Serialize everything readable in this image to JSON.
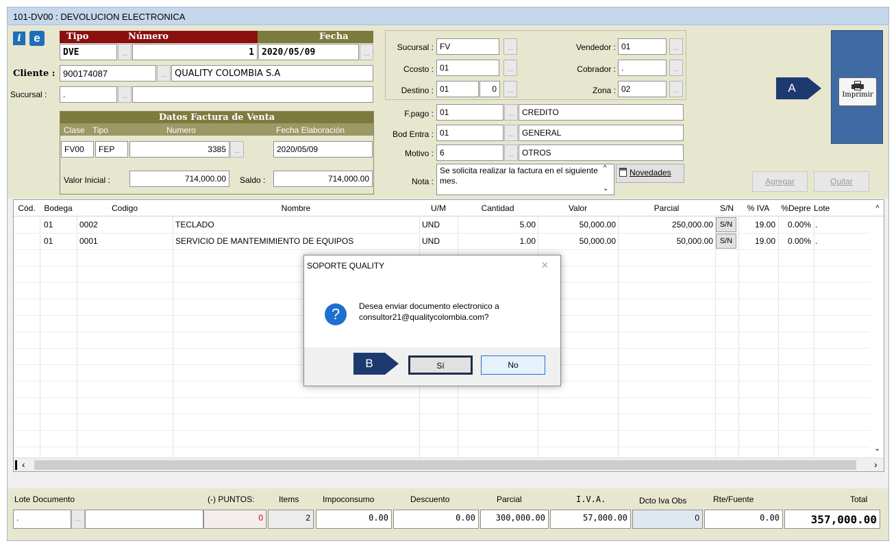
{
  "window": {
    "title": "101-DV00 : DEVOLUCION ELECTRONICA"
  },
  "header": {
    "info_icon": "i",
    "e_icon": "e",
    "tipo_label": "Tipo",
    "numero_label": "Número",
    "fecha_label": "Fecha",
    "tipo_value": "DVE",
    "numero_value": "1",
    "fecha_value": "2020/05/09",
    "cliente_label": "Cliente :",
    "cliente_code": "900174087",
    "cliente_name": "QUALITY COLOMBIA S.A",
    "sucursal_label": "Sucursal :",
    "sucursal_value": ".",
    "dots": "...",
    "datos_title": "Datos Factura de Venta",
    "datos_clase_label": "Clase",
    "datos_tipo_label": "Tipo",
    "datos_numero_label": "Numero",
    "datos_fecha_label": "Fecha Elaboración",
    "datos_clase": "FV00",
    "datos_tipo": "FEP",
    "datos_numero": "3385",
    "datos_fecha": "2020/05/09",
    "valor_inicial_label": "Valor Inicial :",
    "valor_inicial": "714,000.00",
    "saldo_label": "Saldo :",
    "saldo": "714,000.00"
  },
  "middle": {
    "sucursal_label": "Sucursal :",
    "sucursal": "FV",
    "ccosto_label": "Ccosto :",
    "ccosto": "01",
    "destino_label": "Destino :",
    "destino": "01",
    "destino2": "0",
    "vendedor_label": "Vendedor :",
    "vendedor": "01",
    "cobrador_label": "Cobrador :",
    "cobrador": ".",
    "zona_label": "Zona :",
    "zona": "02",
    "fpago_label": "F.pago :",
    "fpago": "01",
    "fpago_desc": "CREDITO",
    "bod_label": "Bod Entra :",
    "bod": "01",
    "bod_desc": "GENERAL",
    "motivo_label": "Motivo :",
    "motivo": "6",
    "motivo_desc": "OTROS",
    "nota_label": "Nota :",
    "nota": "Se solicita realizar la factura en el siguiente mes.",
    "novedades_label": "Novedades"
  },
  "right": {
    "imprimir_label": "Imprimir",
    "agregar_label": "Agregar",
    "quitar_label": "Quitar",
    "callout_a": "A",
    "callout_b": "B"
  },
  "grid": {
    "columns": [
      "Cód.",
      "Bodega",
      "Codigo",
      "Nombre",
      "U/M",
      "Cantidad",
      "Valor",
      "Parcial",
      "S/N",
      "% IVA",
      "%Depre",
      "Lote"
    ],
    "rows": [
      {
        "bodega": "01",
        "codigo": "0002",
        "nombre": "TECLADO",
        "um": "UND",
        "cantidad": "5.00",
        "valor": "50,000.00",
        "parcial": "250,000.00",
        "sn": "S/N",
        "iva": "19.00",
        "depre": "0.00%",
        "lote": "."
      },
      {
        "bodega": "01",
        "codigo": "0001",
        "nombre": "SERVICIO DE MANTEMIMIENTO DE EQUIPOS",
        "um": "UND",
        "cantidad": "1.00",
        "valor": "50,000.00",
        "parcial": "50,000.00",
        "sn": "S/N",
        "iva": "19.00",
        "depre": "0.00%",
        "lote": "."
      }
    ]
  },
  "dialog": {
    "title": "SOPORTE QUALITY",
    "message": "Desea enviar documento electronico a consultor21@qualitycolombia.com?",
    "yes": "Sí",
    "no": "No"
  },
  "footer": {
    "lote_label": "Lote Documento",
    "puntos_label": "(-) PUNTOS:",
    "items_label": "Items",
    "impoconsumo_label": "Impoconsumo",
    "descuento_label": "Descuento",
    "parcial_label": "Parcial",
    "iva_label": "I.V.A.",
    "dcto_label": "Dcto Iva Obs",
    "rte_label": "Rte/Fuente",
    "total_label": "Total",
    "lote": ".",
    "puntos": "0",
    "items": "2",
    "impoconsumo": "0.00",
    "descuento": "0.00",
    "parcial": "300,000.00",
    "iva": "57,000.00",
    "dcto": "0",
    "rte": "0.00",
    "total": "357,000.00"
  },
  "colors": {
    "accent_red": "#8a0f0f",
    "accent_olive": "#7d7a3e",
    "panel_bg": "#e7e6cf",
    "callout": "#1c3a70"
  }
}
